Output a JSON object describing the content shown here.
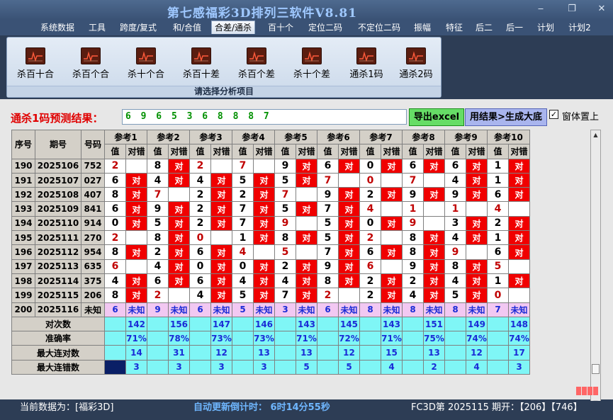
{
  "app": {
    "title": "第七感福彩3D排列三软件V8.81"
  },
  "window_controls": {
    "minimize": "‒",
    "restore": "❐",
    "close": "✕"
  },
  "menu": [
    {
      "label": "系统数据"
    },
    {
      "label": "工具"
    },
    {
      "label": "跨度/复式"
    },
    {
      "label": "和/合值"
    },
    {
      "label": "合差/通杀",
      "active": true
    },
    {
      "label": "百十个"
    },
    {
      "label": "定位二码"
    },
    {
      "label": "不定位二码"
    },
    {
      "label": "振幅"
    },
    {
      "label": "特征"
    },
    {
      "label": "后二"
    },
    {
      "label": "后一"
    },
    {
      "label": "计划"
    },
    {
      "label": "计划2"
    }
  ],
  "ribbon": {
    "buttons": [
      {
        "label": "杀百十合",
        "icon": "chart-pulse-icon"
      },
      {
        "label": "杀百个合",
        "icon": "chart-pulse-icon"
      },
      {
        "label": "杀十个合",
        "icon": "chart-pulse-icon"
      },
      {
        "label": "杀百十差",
        "icon": "chart-pulse-icon"
      },
      {
        "label": "杀百个差",
        "icon": "chart-pulse-icon"
      },
      {
        "label": "杀十个差",
        "icon": "chart-pulse-icon"
      },
      {
        "label": "通杀1码",
        "icon": "chart-pulse-icon"
      },
      {
        "label": "通杀2码",
        "icon": "chart-pulse-icon"
      }
    ],
    "caption": "请选择分析项目"
  },
  "prediction": {
    "label": "通杀1码预测结果：",
    "value": "6 9 6 5 3 6 8 8 8 7",
    "export_button": "导出excel",
    "generate_button": "用结果>生成大底",
    "topmost_label": "窗体置上",
    "topmost_checked": true,
    "check_mark": "✓"
  },
  "table": {
    "headers": {
      "seq": "序号",
      "period": "期号",
      "number": "号码",
      "value": "值",
      "result": "对错"
    },
    "refs": [
      "参考1",
      "参考2",
      "参考3",
      "参考4",
      "参考5",
      "参考6",
      "参考7",
      "参考8",
      "参考9",
      "参考10"
    ],
    "hit_text": "对",
    "rows": [
      {
        "seq": "190",
        "period": "2025106",
        "number": "752",
        "cells": [
          [
            "2",
            false
          ],
          [
            "8",
            true
          ],
          [
            "2",
            false
          ],
          [
            "7",
            false
          ],
          [
            "9",
            true
          ],
          [
            "6",
            true
          ],
          [
            "0",
            true
          ],
          [
            "6",
            true
          ],
          [
            "6",
            true
          ],
          [
            "1",
            true
          ]
        ]
      },
      {
        "seq": "191",
        "period": "2025107",
        "number": "027",
        "cells": [
          [
            "6",
            true
          ],
          [
            "4",
            true
          ],
          [
            "4",
            true
          ],
          [
            "5",
            true
          ],
          [
            "5",
            true
          ],
          [
            "7",
            false
          ],
          [
            "0",
            false
          ],
          [
            "7",
            false
          ],
          [
            "4",
            true
          ],
          [
            "1",
            true
          ]
        ]
      },
      {
        "seq": "192",
        "period": "2025108",
        "number": "407",
        "cells": [
          [
            "8",
            true
          ],
          [
            "7",
            false
          ],
          [
            "2",
            true
          ],
          [
            "2",
            true
          ],
          [
            "7",
            false
          ],
          [
            "9",
            true
          ],
          [
            "2",
            true
          ],
          [
            "9",
            true
          ],
          [
            "9",
            true
          ],
          [
            "6",
            true
          ]
        ]
      },
      {
        "seq": "193",
        "period": "2025109",
        "number": "841",
        "cells": [
          [
            "6",
            true
          ],
          [
            "9",
            true
          ],
          [
            "2",
            true
          ],
          [
            "7",
            true
          ],
          [
            "5",
            true
          ],
          [
            "7",
            true
          ],
          [
            "4",
            false
          ],
          [
            "1",
            false
          ],
          [
            "1",
            false
          ],
          [
            "4",
            false
          ]
        ]
      },
      {
        "seq": "194",
        "period": "2025110",
        "number": "914",
        "cells": [
          [
            "0",
            true
          ],
          [
            "5",
            true
          ],
          [
            "2",
            true
          ],
          [
            "7",
            true
          ],
          [
            "9",
            false
          ],
          [
            "5",
            true
          ],
          [
            "0",
            true
          ],
          [
            "9",
            false
          ],
          [
            "3",
            true
          ],
          [
            "2",
            true
          ]
        ]
      },
      {
        "seq": "195",
        "period": "2025111",
        "number": "270",
        "cells": [
          [
            "2",
            false
          ],
          [
            "8",
            true
          ],
          [
            "0",
            false
          ],
          [
            "1",
            true
          ],
          [
            "8",
            true
          ],
          [
            "5",
            true
          ],
          [
            "2",
            false
          ],
          [
            "8",
            true
          ],
          [
            "4",
            true
          ],
          [
            "1",
            true
          ]
        ]
      },
      {
        "seq": "196",
        "period": "2025112",
        "number": "954",
        "cells": [
          [
            "8",
            true
          ],
          [
            "2",
            true
          ],
          [
            "6",
            true
          ],
          [
            "4",
            false
          ],
          [
            "5",
            false
          ],
          [
            "7",
            true
          ],
          [
            "6",
            true
          ],
          [
            "8",
            true
          ],
          [
            "9",
            false
          ],
          [
            "6",
            true
          ]
        ]
      },
      {
        "seq": "197",
        "period": "2025113",
        "number": "635",
        "cells": [
          [
            "6",
            false
          ],
          [
            "4",
            true
          ],
          [
            "0",
            true
          ],
          [
            "0",
            true
          ],
          [
            "2",
            true
          ],
          [
            "9",
            true
          ],
          [
            "6",
            false
          ],
          [
            "9",
            true
          ],
          [
            "8",
            true
          ],
          [
            "5",
            false
          ]
        ]
      },
      {
        "seq": "198",
        "period": "2025114",
        "number": "375",
        "cells": [
          [
            "4",
            true
          ],
          [
            "6",
            true
          ],
          [
            "6",
            true
          ],
          [
            "4",
            true
          ],
          [
            "4",
            true
          ],
          [
            "8",
            true
          ],
          [
            "2",
            true
          ],
          [
            "2",
            true
          ],
          [
            "4",
            true
          ],
          [
            "1",
            true
          ]
        ]
      },
      {
        "seq": "199",
        "period": "2025115",
        "number": "206",
        "cells": [
          [
            "8",
            true
          ],
          [
            "2",
            false
          ],
          [
            "4",
            true
          ],
          [
            "5",
            true
          ],
          [
            "7",
            true
          ],
          [
            "2",
            false
          ],
          [
            "2",
            true
          ],
          [
            "4",
            true
          ],
          [
            "5",
            true
          ],
          [
            "0",
            false
          ]
        ]
      }
    ],
    "pending_row": {
      "seq": "200",
      "period": "2025116",
      "number": "未知",
      "values": [
        "6",
        "9",
        "6",
        "5",
        "3",
        "6",
        "8",
        "8",
        "8",
        "7"
      ],
      "result_text": "未知"
    },
    "stats": [
      {
        "label": "对次数",
        "values": [
          "142",
          "156",
          "147",
          "146",
          "143",
          "145",
          "143",
          "151",
          "149",
          "148"
        ]
      },
      {
        "label": "准确率",
        "values": [
          "71%",
          "78%",
          "73%",
          "73%",
          "71%",
          "72%",
          "71%",
          "75%",
          "74%",
          "74%"
        ]
      },
      {
        "label": "最大连对数",
        "values": [
          "14",
          "31",
          "12",
          "13",
          "13",
          "12",
          "15",
          "13",
          "12",
          "17"
        ]
      },
      {
        "label": "最大连错数",
        "values": [
          "3",
          "3",
          "3",
          "3",
          "5",
          "5",
          "4",
          "2",
          "4",
          "3"
        ]
      }
    ]
  },
  "status": {
    "left": "当前数据为：[福彩3D]",
    "countdown": "自动更新倒计时：  6时14分55秒",
    "right": "FC3D第 2025115 期开：【206】【746】"
  },
  "colors": {
    "hit": "#f00000",
    "pending": "#f2c8f2",
    "stats": "#7ff6f6",
    "accent_text": "#1a2bd6",
    "prediction_label": "#e00000"
  }
}
